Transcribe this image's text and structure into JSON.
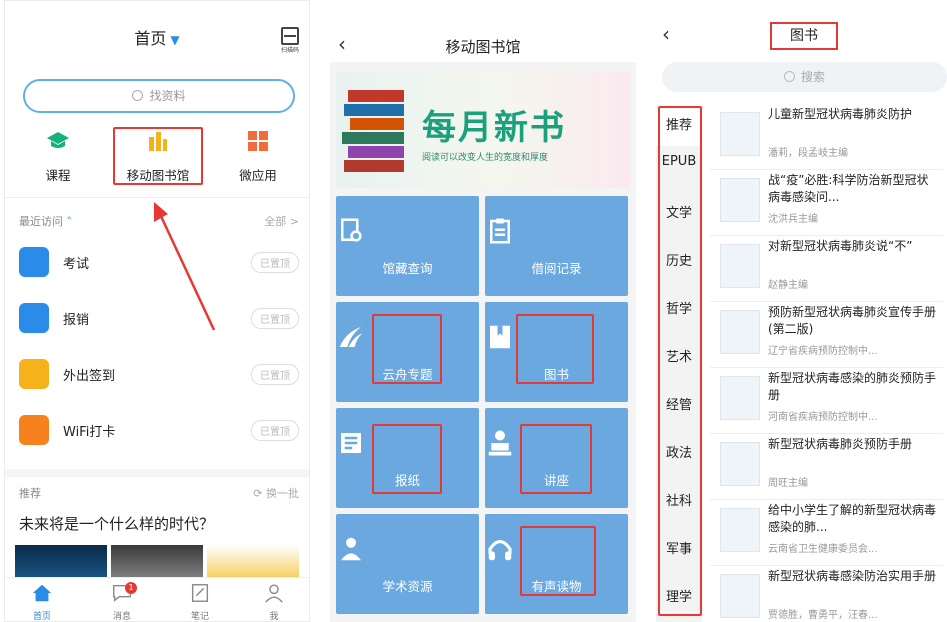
{
  "colors": {
    "accent": "#2a8ce8",
    "tile": "#6aa8df",
    "highlight": "#e53935",
    "banner_text": "#1aa07a"
  },
  "panel1": {
    "header_title": "首页",
    "scan_label": "扫描码",
    "search_placeholder": "找资料",
    "quick": [
      {
        "label": "课程",
        "icon": "graduation-cap-icon"
      },
      {
        "label": "移动图书馆",
        "icon": "library-icon"
      },
      {
        "label": "微应用",
        "icon": "grid-apps-icon"
      }
    ],
    "recent_label": "最近访问",
    "all_label": "全部 >",
    "apps": [
      {
        "name": "考试",
        "icon": "exam-icon",
        "color": "#2a8ce8",
        "pin": "已置顶"
      },
      {
        "name": "报销",
        "icon": "reimburse-icon",
        "color": "#2a8ce8",
        "pin": "已置顶"
      },
      {
        "name": "外出签到",
        "icon": "checkin-icon",
        "color": "#f6b21b",
        "pin": "已置顶"
      },
      {
        "name": "WiFi打卡",
        "icon": "wifi-icon",
        "color": "#f5821f",
        "pin": "已置顶"
      }
    ],
    "recommend_label": "推荐",
    "refresh_label": "换一批",
    "headline": "未来将是一个什么样的时代？",
    "tabs": [
      {
        "label": "首页",
        "icon": "home-icon"
      },
      {
        "label": "消息",
        "icon": "message-icon",
        "badge": "1"
      },
      {
        "label": "笔记",
        "icon": "note-icon"
      },
      {
        "label": "我",
        "icon": "profile-icon"
      }
    ]
  },
  "panel2": {
    "title": "移动图书馆",
    "banner_title": "每月新书",
    "banner_sub": "阅读可以改变人生的宽度和厚度",
    "tiles": [
      {
        "label": "馆藏查询",
        "icon": "catalog-search-icon"
      },
      {
        "label": "借阅记录",
        "icon": "clipboard-icon"
      },
      {
        "label": "云舟专题",
        "icon": "yunzhou-icon"
      },
      {
        "label": "图书",
        "icon": "book-icon"
      },
      {
        "label": "报纸",
        "icon": "newspaper-icon"
      },
      {
        "label": "讲座",
        "icon": "lecture-icon"
      },
      {
        "label": "学术资源",
        "icon": "scholar-icon"
      },
      {
        "label": "有声读物",
        "icon": "headphones-icon"
      }
    ]
  },
  "panel3": {
    "title": "图书",
    "search_placeholder": "搜索",
    "categories": [
      "推荐",
      "EPUB",
      "文学",
      "历史",
      "哲学",
      "艺术",
      "经管",
      "政法",
      "社科",
      "军事",
      "理学"
    ],
    "books": [
      {
        "title": "儿童新型冠状病毒肺炎防护",
        "author": "潘莉，段孟岐主编"
      },
      {
        "title": "战“疫”必胜:科学防治新型冠状病毒感染问...",
        "author": "沈洪兵主编"
      },
      {
        "title": "对新型冠状病毒肺炎说“不”",
        "author": "赵静主编"
      },
      {
        "title": "预防新型冠状病毒肺炎宣传手册(第二版)",
        "author": "辽宁省疾病预防控制中..."
      },
      {
        "title": "新型冠状病毒感染的肺炎预防手册",
        "author": "河南省疾病预防控制中..."
      },
      {
        "title": "新型冠状病毒肺炎预防手册",
        "author": "周旺主编"
      },
      {
        "title": "给中小学生了解的新型冠状病毒感染的肺...",
        "author": "云南省卫生健康委员会..."
      },
      {
        "title": "新型冠状病毒感染防治实用手册",
        "author": "贾德胜，曹勇平，汪春..."
      }
    ]
  }
}
